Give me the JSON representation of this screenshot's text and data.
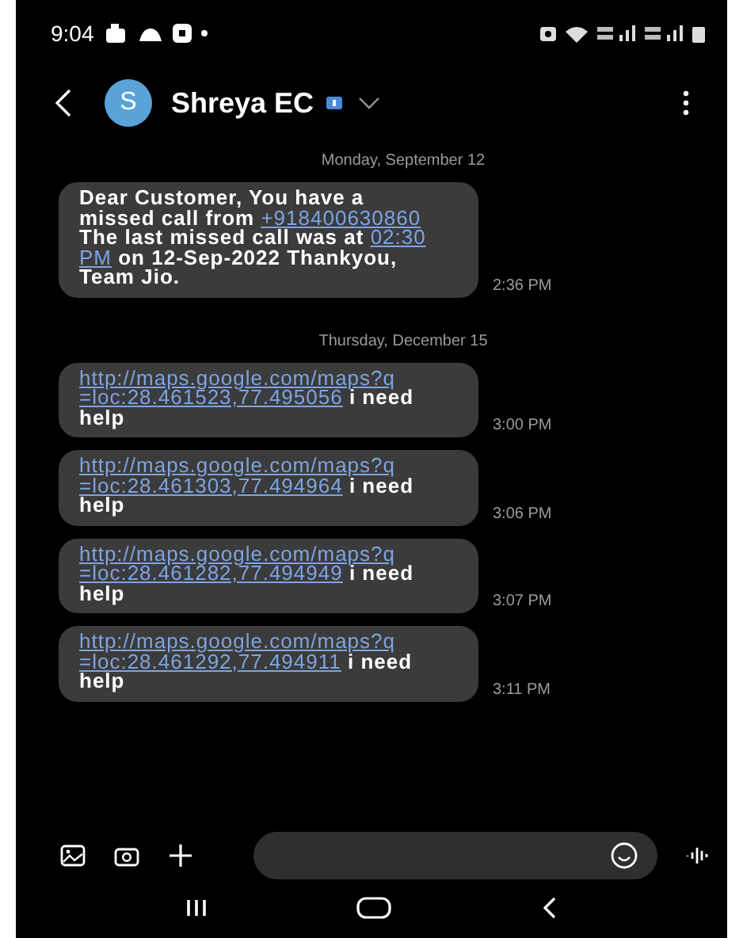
{
  "status_bar": {
    "time": "9:04"
  },
  "header": {
    "avatar_letter": "S",
    "contact_name": "Shreya EC"
  },
  "conversation": [
    {
      "kind": "date",
      "text": "Monday, September 12"
    },
    {
      "kind": "message",
      "time": "2:36 PM",
      "parts": [
        {
          "kind": "text",
          "text": "Dear Customer, You have a missed call from "
        },
        {
          "kind": "link",
          "text": "+918400630860"
        },
        {
          "kind": "text",
          "text": " The last missed call was at "
        },
        {
          "kind": "link",
          "text": "02:30"
        },
        {
          "kind": "link",
          "text": "PM"
        },
        {
          "kind": "text",
          "text": " on 12-Sep-2022 Thankyou, Team Jio."
        }
      ]
    },
    {
      "kind": "date",
      "text": "Thursday, December 15"
    },
    {
      "kind": "message",
      "time": "3:00 PM",
      "parts": [
        {
          "kind": "link",
          "text": "http://maps.google.com/maps?q"
        },
        {
          "kind": "link",
          "text": "=loc:28.461523,77.495056"
        },
        {
          "kind": "text",
          "text": " i need help"
        }
      ]
    },
    {
      "kind": "message",
      "time": "3:06 PM",
      "parts": [
        {
          "kind": "link",
          "text": "http://maps.google.com/maps?q"
        },
        {
          "kind": "link",
          "text": "=loc:28.461303,77.494964"
        },
        {
          "kind": "text",
          "text": " i need help"
        }
      ]
    },
    {
      "kind": "message",
      "time": "3:07 PM",
      "parts": [
        {
          "kind": "link",
          "text": "http://maps.google.com/maps?q"
        },
        {
          "kind": "link",
          "text": "=loc:28.461282,77.494949"
        },
        {
          "kind": "text",
          "text": " i need help"
        }
      ]
    },
    {
      "kind": "message",
      "time": "3:11 PM",
      "parts": [
        {
          "kind": "link",
          "text": "http://maps.google.com/maps?q"
        },
        {
          "kind": "link",
          "text": "=loc:28.461292,77.494911"
        },
        {
          "kind": "text",
          "text": " i need help"
        }
      ]
    }
  ]
}
